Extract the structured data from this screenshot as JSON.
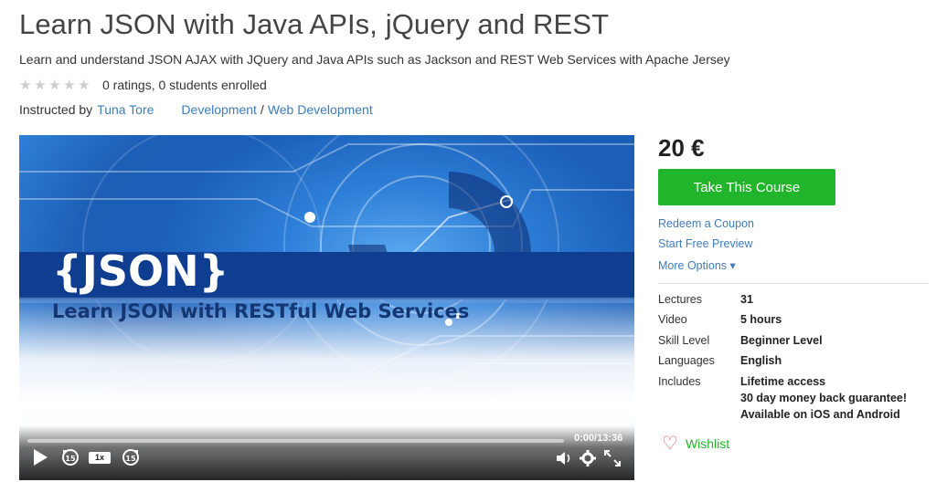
{
  "course": {
    "title": "Learn JSON with Java APIs, jQuery and REST",
    "subtitle": "Learn and understand JSON AJAX with JQuery and Java APIs such as Jackson and REST Web Services with Apache Jersey",
    "rating_text": "0 ratings, 0 students enrolled",
    "rating_value": 0,
    "instructed_by_label": "Instructed by",
    "instructor": "Tuna Tore",
    "category": "Development",
    "category_sep": "/",
    "subcategory": "Web Development"
  },
  "video": {
    "logo_text": "{JSON}",
    "headline": "Learn JSON with RESTful Web Services",
    "time": "0:00/13:36",
    "progress": 0,
    "speed": "1x",
    "rewind_seconds": "15",
    "forward_seconds": "15"
  },
  "sidebar": {
    "price": "20 €",
    "take_course": "Take This Course",
    "redeem": "Redeem a Coupon",
    "preview": "Start Free Preview",
    "more_options": "More Options ▾",
    "details": {
      "lectures_label": "Lectures",
      "lectures": "31",
      "video_label": "Video",
      "video": "5 hours",
      "skill_label": "Skill Level",
      "skill": "Beginner Level",
      "languages_label": "Languages",
      "languages": "English",
      "includes_label": "Includes",
      "includes": [
        "Lifetime access",
        "30 day money back guarantee!",
        "Available on iOS and Android"
      ]
    },
    "wishlist": "Wishlist"
  },
  "colors": {
    "accent": "#20b52b",
    "link": "#3e7cba",
    "heart": "#e06060"
  }
}
